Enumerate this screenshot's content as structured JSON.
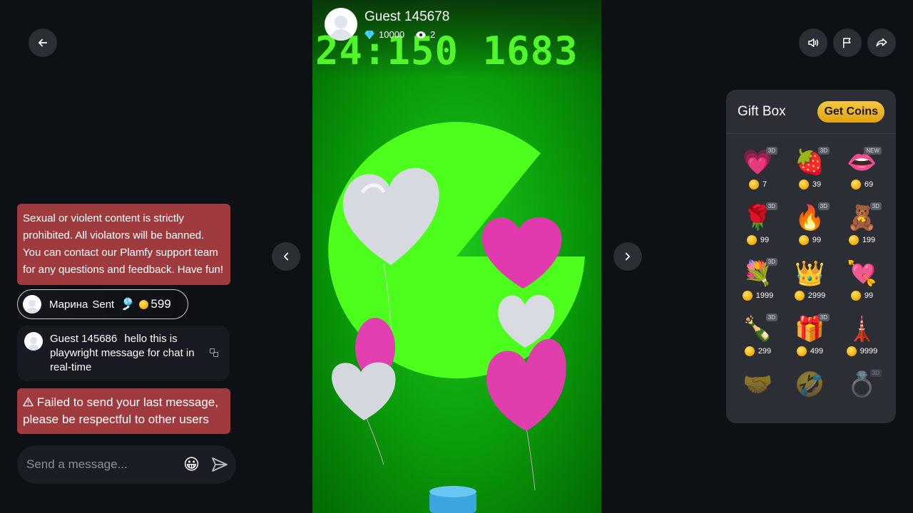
{
  "stream": {
    "streamer_name": "Guest 145678",
    "diamonds": "10000",
    "viewers": "2",
    "clock_text": "24:150 1683"
  },
  "chat": {
    "notice": "Sexual or violent content is strictly prohibited. All violators will be banned. You can contact our Plamfy support team for any questions and feedback. Have fun!",
    "gift_message": {
      "name": "Марина",
      "action": "Sent",
      "gift_icon": "🎐",
      "amount": "599"
    },
    "message": {
      "name": "Guest 145686",
      "text": "hello this is playwright message for chat in real-time"
    },
    "error": "Failed to send your last message, please be respectful to other users",
    "composer_placeholder": "Send a message...",
    "emoji": "😀"
  },
  "giftbox": {
    "title": "Gift Box",
    "get_coins": "Get Coins",
    "gifts": [
      {
        "name": "follow-me-heart",
        "icon": "💗",
        "price": "7",
        "badge": "3D"
      },
      {
        "name": "strawberry",
        "icon": "🍓",
        "price": "39",
        "badge": "3D"
      },
      {
        "name": "lips",
        "icon": "👄",
        "price": "69",
        "badge": "NEW"
      },
      {
        "name": "rose",
        "icon": "🌹",
        "price": "99",
        "badge": "3D"
      },
      {
        "name": "fire",
        "icon": "🔥",
        "price": "99",
        "badge": "3D"
      },
      {
        "name": "teddy-bear",
        "icon": "🧸",
        "price": "199",
        "badge": "3D"
      },
      {
        "name": "rose-bouquet",
        "icon": "💐",
        "price": "1999",
        "badge": "3D"
      },
      {
        "name": "tiara",
        "icon": "👑",
        "price": "2999",
        "badge": ""
      },
      {
        "name": "heart-arrow",
        "icon": "💘",
        "price": "99",
        "badge": ""
      },
      {
        "name": "champagne",
        "icon": "🍾",
        "price": "299",
        "badge": "3D"
      },
      {
        "name": "gift-box-heart",
        "icon": "🎁",
        "price": "499",
        "badge": "3D"
      },
      {
        "name": "eiffel-tower",
        "icon": "🗼",
        "price": "9999",
        "badge": ""
      },
      {
        "name": "hand",
        "icon": "🤝",
        "price": "",
        "badge": ""
      },
      {
        "name": "laughing-face",
        "icon": "🤣",
        "price": "",
        "badge": ""
      },
      {
        "name": "ring",
        "icon": "💍",
        "price": "",
        "badge": "3D"
      }
    ]
  }
}
